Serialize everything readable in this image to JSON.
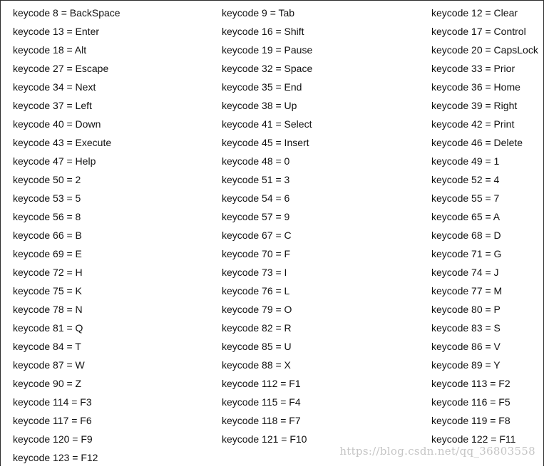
{
  "keycodes": [
    "keycode 8 = BackSpace",
    "keycode 9 = Tab",
    "keycode 12 = Clear",
    "keycode 13 = Enter",
    "keycode 16 = Shift",
    "keycode 17 = Control",
    "keycode 18 = Alt",
    "keycode 19 = Pause",
    "keycode 20 = CapsLock",
    "keycode 27 = Escape",
    "keycode 32 = Space",
    "keycode 33 = Prior",
    "keycode 34 = Next",
    "keycode 35 = End",
    "keycode 36 = Home",
    "keycode 37 = Left",
    "keycode 38 = Up",
    "keycode 39 = Right",
    "keycode 40 = Down",
    "keycode 41 = Select",
    "keycode 42 = Print",
    "keycode 43 = Execute",
    "keycode 45 = Insert",
    "keycode 46 = Delete",
    "keycode 47 = Help",
    "keycode 48 = 0",
    "keycode 49 = 1",
    "keycode 50 = 2",
    "keycode 51 = 3",
    "keycode 52 = 4",
    "keycode 53 = 5",
    "keycode 54 = 6",
    "keycode 55 = 7",
    "keycode 56 = 8",
    "keycode 57 = 9",
    "keycode 65 = A",
    "keycode 66 = B",
    "keycode 67 = C",
    "keycode 68 = D",
    "keycode 69 = E",
    "keycode 70 = F",
    "keycode 71 = G",
    "keycode 72 = H",
    "keycode 73 = I",
    "keycode 74 = J",
    "keycode 75 = K",
    "keycode 76 = L",
    "keycode 77 = M",
    "keycode 78 = N",
    "keycode 79 = O",
    "keycode 80 = P",
    "keycode 81 = Q",
    "keycode 82 = R",
    "keycode 83 = S",
    "keycode 84 = T",
    "keycode 85 = U",
    "keycode 86 = V",
    "keycode 87 = W",
    "keycode 88 = X",
    "keycode 89 = Y",
    "keycode 90 = Z",
    "keycode 112 = F1",
    "keycode 113 = F2",
    "keycode 114 = F3",
    "keycode 115 = F4",
    "keycode 116 = F5",
    "keycode 117 = F6",
    "keycode 118 = F7",
    "keycode 119 = F8",
    "keycode 120 = F9",
    "keycode 121 = F10",
    "keycode 122 = F11",
    "keycode 123 = F12"
  ],
  "watermark": "https://blog.csdn.net/qq_36803558",
  "colors": {
    "text": "#111111",
    "border": "#2b2b2b",
    "background": "#ffffff"
  }
}
